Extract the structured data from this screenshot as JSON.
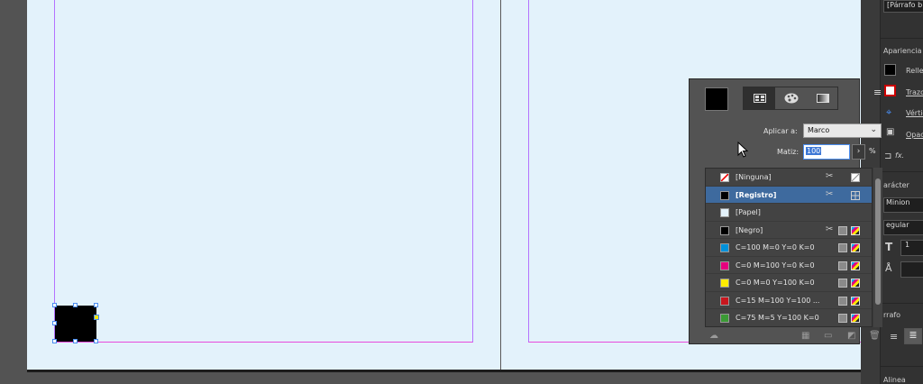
{
  "document": {
    "colors": {
      "pasteboard": "#535353",
      "page": "#e3f2fb",
      "margin_guide": "#b473ff",
      "bleed_guide": "#e84cdc",
      "frame_fill": "#000000"
    }
  },
  "right_panel": {
    "top_field": "[Párrafo b",
    "appearance_label": "Apariencia",
    "fill_label": "Rellen",
    "stroke_label": "Trazo",
    "vertices_label": "Vértic",
    "opacity_label": "Opac",
    "fx_label": "fx.",
    "character_label": "arácter",
    "font_name": "Minion",
    "font_style": "egular",
    "size_value": "1",
    "paragraph_label": "rrafo",
    "align_label": "Alinea"
  },
  "swatches_panel": {
    "icons": [
      "grid-view-icon",
      "palette-icon",
      "gradient-icon"
    ],
    "menu_icon": "hamburger-menu-icon",
    "apply_to_label": "Aplicar a:",
    "apply_to_value": "Marco",
    "tint_label": "Matiz:",
    "tint_value": "100",
    "percent_sign": "%",
    "swatches": [
      {
        "name": "[Ninguna]",
        "color": "none",
        "selected": false,
        "icons": [
          "scissors",
          "none-mode"
        ]
      },
      {
        "name": "[Registro]",
        "color": "#000000",
        "selected": true,
        "icons": [
          "scissors",
          "registration"
        ]
      },
      {
        "name": "[Papel]",
        "color": "#e3f2fb",
        "selected": false,
        "icons": []
      },
      {
        "name": "[Negro]",
        "color": "#000000",
        "selected": false,
        "icons": [
          "scissors",
          "process",
          "cmyk"
        ]
      },
      {
        "name": "C=100 M=0 Y=0 K=0",
        "color": "#0091da",
        "selected": false,
        "icons": [
          "process",
          "cmyk"
        ]
      },
      {
        "name": "C=0 M=100 Y=0 K=0",
        "color": "#e6007e",
        "selected": false,
        "icons": [
          "process",
          "cmyk"
        ]
      },
      {
        "name": "C=0 M=0 Y=100 K=0",
        "color": "#ffec00",
        "selected": false,
        "icons": [
          "process",
          "cmyk"
        ]
      },
      {
        "name": "C=15 M=100 Y=100 ...",
        "color": "#c8161e",
        "selected": false,
        "icons": [
          "process",
          "cmyk"
        ]
      },
      {
        "name": "C=75 M=5 Y=100 K=0",
        "color": "#3b9a35",
        "selected": false,
        "icons": [
          "process",
          "cmyk"
        ]
      }
    ],
    "footer_icons": [
      "cloud-icon",
      "new-group-icon",
      "folder-icon",
      "new-swatch-icon",
      "trash-icon"
    ]
  }
}
